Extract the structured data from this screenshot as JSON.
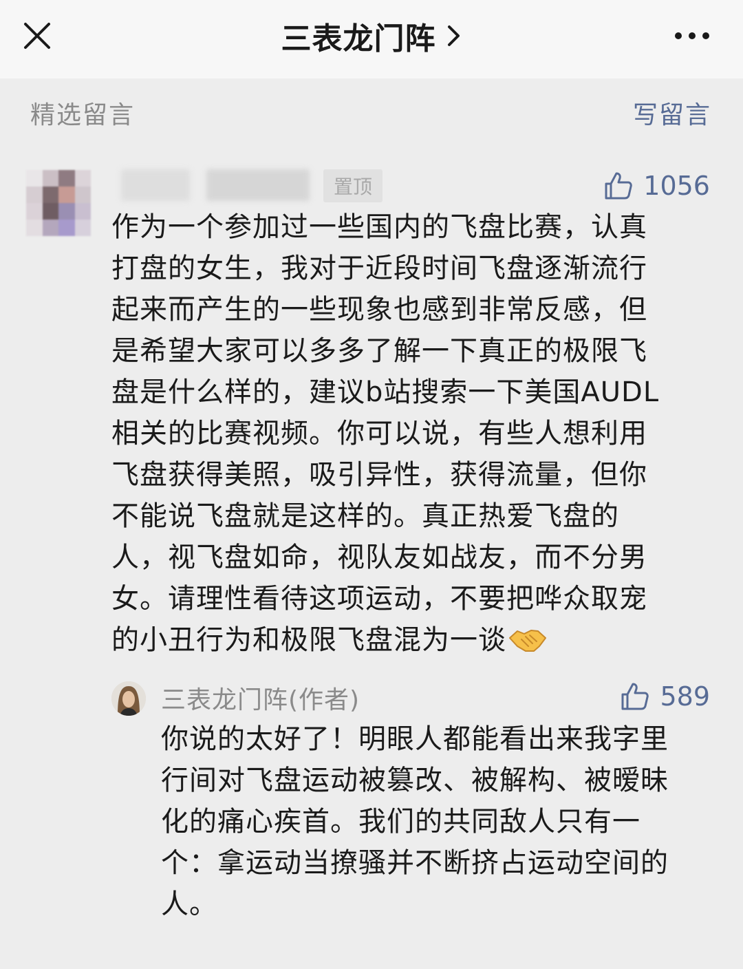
{
  "header": {
    "title": "三表龙门阵",
    "close_icon": "close-icon",
    "chevron_icon": "chevron-right-icon",
    "more_icon": "more-icon"
  },
  "section": {
    "title": "精选留言",
    "write_label": "写留言"
  },
  "comment": {
    "pin_label": "置顶",
    "like_count": "1056",
    "text": "作为一个参加过一些国内的飞盘比赛，认真\n打盘的女生，我对于近段时间飞盘逐渐流行\n起来而产生的一些现象也感到非常反感，但\n是希望大家可以多多了解一下真正的极限飞\n盘是什么样的，建议b站搜索一下美国AUDL\n相关的比赛视频。你可以说，有些人想利用\n飞盘获得美照，吸引异性，获得流量，但你\n不能说飞盘就是这样的。真正热爱飞盘的\n人，视飞盘如命，视队友如战友，而不分男\n女。请理性看待这项运动，不要把哗众取宠\n的小丑行为和极限飞盘混为一谈",
    "emoji_icon": "handshake-icon"
  },
  "reply": {
    "author": "三表龙门阵(作者)",
    "like_count": "589",
    "text": "你说的太好了！明眼人都能看出来我字里\n行间对飞盘运动被篡改、被解构、被暧昧\n化的痛心疾首。我们的共同敌人只有一\n个：拿运动当撩骚并不断挤占运动空间的\n人。"
  },
  "colors": {
    "background": "#ededed",
    "topbar": "#f7f7f7",
    "link": "#576b95",
    "muted": "#8a8a8a"
  }
}
